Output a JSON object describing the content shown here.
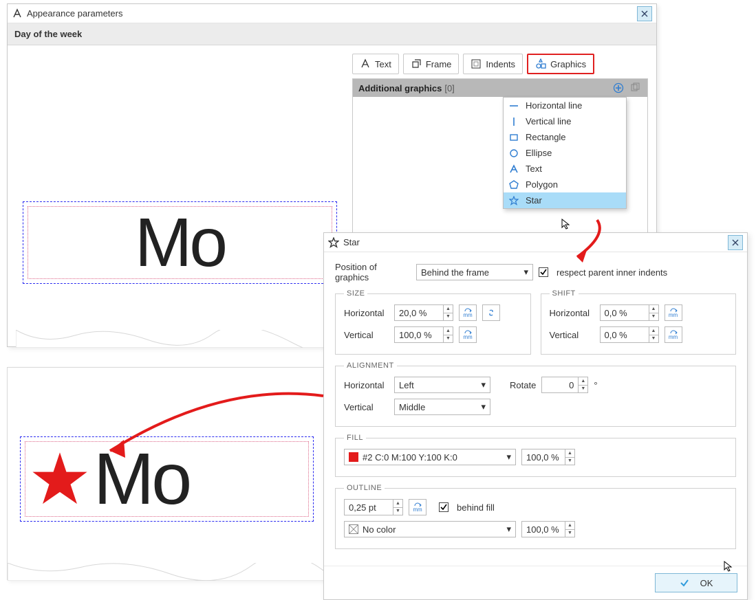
{
  "appWindow": {
    "title": "Appearance parameters",
    "section": "Day of the week",
    "preview_text": "Mo",
    "tabs": {
      "text": "Text",
      "frame": "Frame",
      "indents": "Indents",
      "graphics": "Graphics"
    },
    "panel": {
      "title": "Additional graphics",
      "count": "[0]"
    },
    "menu": {
      "hline": "Horizontal line",
      "vline": "Vertical line",
      "rect": "Rectangle",
      "ellipse": "Ellipse",
      "text": "Text",
      "polygon": "Polygon",
      "star": "Star"
    }
  },
  "starDialog": {
    "title": "Star",
    "position_label": "Position of graphics",
    "position_value": "Behind the frame",
    "respect_label": "respect parent inner indents",
    "size": {
      "legend": "SIZE",
      "h_label": "Horizontal",
      "h_value": "20,0 %",
      "v_label": "Vertical",
      "v_value": "100,0 %",
      "unit": "mm"
    },
    "shift": {
      "legend": "SHIFT",
      "h_label": "Horizontal",
      "h_value": "0,0 %",
      "v_label": "Vertical",
      "v_value": "0,0 %",
      "unit": "mm"
    },
    "align": {
      "legend": "ALIGNMENT",
      "h_label": "Horizontal",
      "h_value": "Left",
      "v_label": "Vertical",
      "v_value": "Middle",
      "rotate_label": "Rotate",
      "rotate_value": "0",
      "rotate_spin_up": "▲",
      "rotate_spin_down": "▼",
      "deg": "°"
    },
    "fill": {
      "legend": "FILL",
      "color_label": "#2 C:0 M:100 Y:100 K:0",
      "color_hex": "#e31b1b",
      "opacity": "100,0 %"
    },
    "outline": {
      "legend": "OUTLINE",
      "weight": "0,25 pt",
      "unit": "mm",
      "behind_label": "behind fill",
      "color_label": "No color",
      "opacity": "100,0 %"
    },
    "ok": "OK"
  },
  "preview2": {
    "text": "Mo"
  },
  "spin": {
    "up": "▲",
    "down": "▼"
  }
}
